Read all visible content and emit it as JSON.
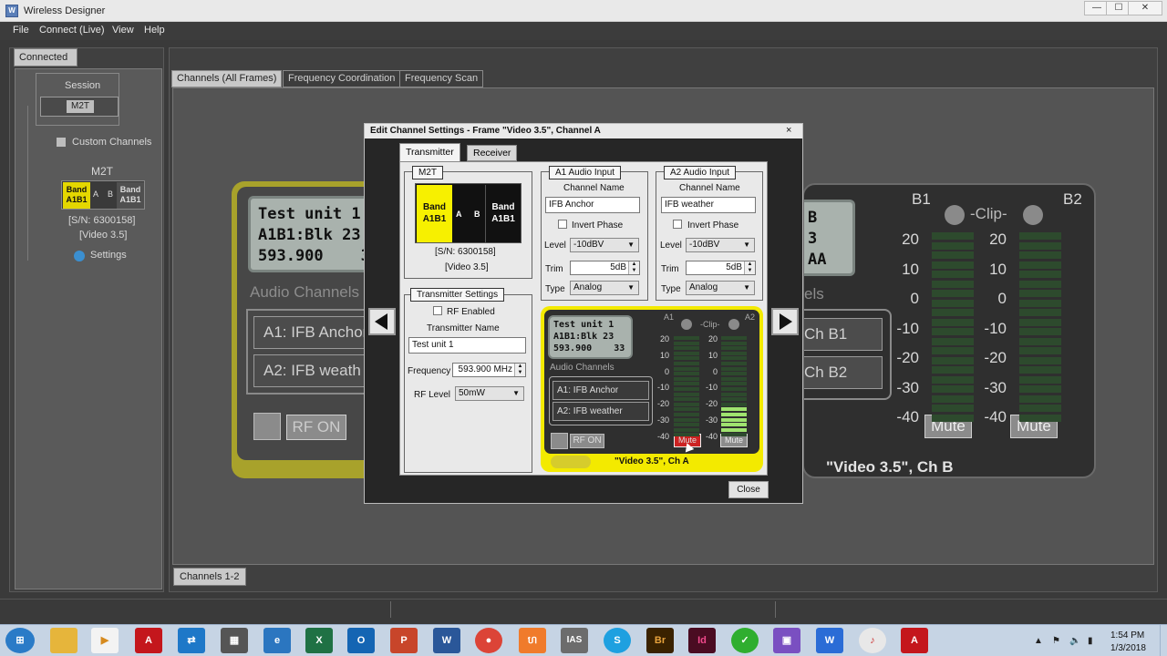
{
  "window": {
    "title": "Wireless Designer",
    "icon": "wd-app-icon",
    "controls": [
      "minimize",
      "maximize",
      "close"
    ]
  },
  "menubar": {
    "items": [
      {
        "label": "File"
      },
      {
        "label": "Connect (Live)"
      },
      {
        "label": "View"
      },
      {
        "label": "Help"
      }
    ]
  },
  "left_panel": {
    "tab": "Connected",
    "session_label": "Session",
    "session_item": "M2T",
    "custom_channels": "Custom Channels",
    "device_title": "M2T",
    "band_left": "Band\nA1B1",
    "a_label": "A",
    "b_label": "B",
    "band_right": "Band\nA1B1",
    "serial": "[S/N: 6300158]",
    "video": "[Video 3.5]",
    "settings": "Settings"
  },
  "main_tabs": [
    {
      "label": "Channels (All Frames)",
      "active": true
    },
    {
      "label": "Frequency Coordination",
      "active": false
    },
    {
      "label": "Frequency Scan",
      "active": false
    }
  ],
  "bottom_tab": "Channels 1-2",
  "bg_card_a": {
    "lcd_line1": "Test unit 1",
    "lcd_line2": "A1B1:Blk 23",
    "lcd_line3": "593.900    33",
    "audio_channels": "Audio Channels",
    "ch1": "A1: IFB Anchor",
    "ch2": "A2: IFB weath",
    "rf_on": "RF ON"
  },
  "bg_card_b": {
    "lcd_line1": "B",
    "lcd_line2": "3",
    "lcd_line3": "AA",
    "audio_suffix": "els",
    "ch1": "Ch B1",
    "ch2": "Ch B2",
    "meter_b1": "B1",
    "meter_clip": "-Clip-",
    "meter_b2": "B2",
    "scale": [
      "20",
      "10",
      "0",
      "-10",
      "-20",
      "-30",
      "-40"
    ],
    "mute": "Mute",
    "footer": "\"Video 3.5\", Ch B"
  },
  "dialog": {
    "title": "Edit Channel Settings - Frame \"Video 3.5\", Channel A",
    "close_x": "×",
    "tabs": [
      {
        "label": "Transmitter",
        "active": true
      },
      {
        "label": "Receiver",
        "active": false
      }
    ],
    "m2t": {
      "group_label": "M2T",
      "band_left": "Band\nA1B1",
      "a": "A",
      "b": "B",
      "band_right": "Band\nA1B1",
      "serial": "[S/N: 6300158]",
      "video": "[Video 3.5]"
    },
    "tx_settings": {
      "group_label": "Transmitter Settings",
      "rf_enabled": "RF Enabled",
      "rf_enabled_checked": false,
      "name_label": "Transmitter Name",
      "name_value": "Test unit 1",
      "frequency_label": "Frequency",
      "frequency_value": "593.900 MHz",
      "rf_level_label": "RF Level",
      "rf_level_value": "50mW"
    },
    "a1": {
      "group_label": "A1 Audio Input",
      "channel_name_label": "Channel Name",
      "channel_name_value": "IFB Anchor",
      "invert_phase": "Invert Phase",
      "level_label": "Level",
      "level_value": "-10dBV",
      "trim_label": "Trim",
      "trim_value": "5dB",
      "type_label": "Type",
      "type_value": "Analog"
    },
    "a2": {
      "group_label": "A2 Audio Input",
      "channel_name_label": "Channel Name",
      "channel_name_value": "IFB weather",
      "invert_phase": "Invert Phase",
      "level_label": "Level",
      "level_value": "-10dBV",
      "trim_label": "Trim",
      "trim_value": "5dB",
      "type_label": "Type",
      "type_value": "Analog"
    },
    "preview": {
      "lcd_line1": "Test unit 1",
      "lcd_line2": "A1B1:Blk 23",
      "lcd_line3": "593.900    33",
      "audio_channels": "Audio Channels",
      "ch1": "A1: IFB Anchor",
      "ch2": "A2: IFB weather",
      "rf_on": "RF ON",
      "meter_a1": "A1",
      "meter_clip": "-Clip-",
      "meter_a2": "A2",
      "scale": [
        "20",
        "10",
        "0",
        "-10",
        "-20",
        "-30",
        "-40"
      ],
      "mute_left": "Mute",
      "mute_right": "Mute",
      "footer": "\"Video 3.5\", Ch A"
    },
    "close_button": "Close"
  },
  "taskbar": {
    "time": "1:54 PM",
    "date": "1/3/2018"
  },
  "colors": {
    "accent_yellow": "#f3ea00",
    "meter_on": "#9fe36f",
    "mute_active": "#cc2222"
  }
}
